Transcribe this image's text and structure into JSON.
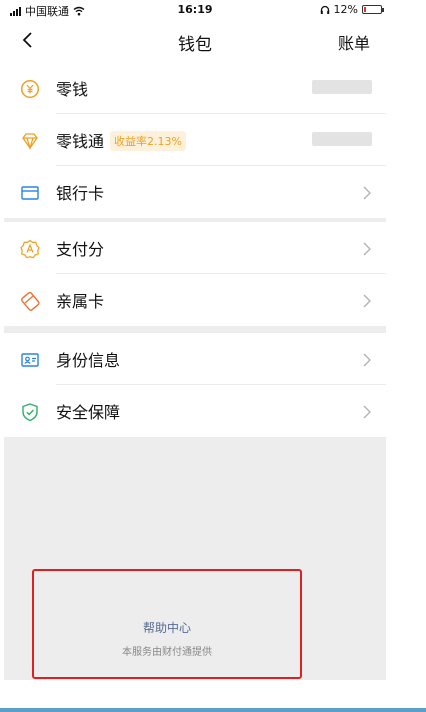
{
  "status_bar": {
    "carrier": "中国联通",
    "time": "16:19",
    "battery": "12%",
    "battery_level": 0.12
  },
  "nav": {
    "title": "钱包",
    "bill": "账单"
  },
  "wallet": {
    "items": [
      {
        "label": "零钱",
        "icon": "yuan-coin-icon"
      },
      {
        "label": "零钱通",
        "icon": "diamond-icon",
        "badge": "收益率2.13%"
      },
      {
        "label": "银行卡",
        "icon": "card-icon"
      }
    ]
  },
  "services": {
    "items": [
      {
        "label": "支付分",
        "icon": "score-badge-icon"
      },
      {
        "label": "亲属卡",
        "icon": "family-card-icon"
      }
    ]
  },
  "security": {
    "items": [
      {
        "label": "身份信息",
        "icon": "id-card-icon"
      },
      {
        "label": "安全保障",
        "icon": "shield-check-icon"
      }
    ]
  },
  "help": {
    "title": "帮助中心",
    "subtitle": "本服务由财付通提供"
  },
  "colors": {
    "accent_gold": "#f0a020",
    "link_blue": "#576b95",
    "highlight_red": "#e02020",
    "battery_low": "#e33333"
  }
}
